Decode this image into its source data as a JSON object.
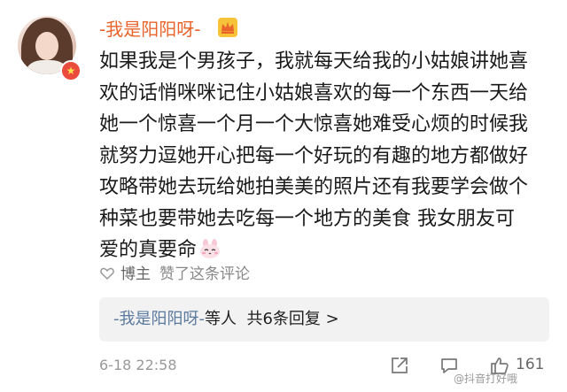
{
  "comment": {
    "username": "-我是阳阳呀-",
    "avatar_badge_icon": "star-badge-icon",
    "crown_icon": "crown-icon",
    "lines": [
      "如果我是个男孩子，我就每天给我的小姑娘讲她喜",
      "欢的话悄咪咪记住小姑娘喜欢的每一个东西一天给",
      "她一个惊喜一个月一个大惊喜她难受心烦的时候我",
      "就努力逗她开心把每一个好玩的有趣的地方都做好",
      "攻略带她去玩给她拍美美的照片还有我要学会做个",
      "种菜也要带她去吃每一个地方的美食 我女朋友可",
      "爱的真要命"
    ],
    "emoji_icon": "bunny-emoji-icon",
    "liked_by_owner": {
      "icon": "heart-outline-icon",
      "owner_label": "博主",
      "text": "赞了这条评论"
    },
    "replies": {
      "name": "-我是阳阳呀-",
      "suffix": "等人",
      "count_text": "共6条回复",
      "chevron": ">"
    },
    "timestamp": "6-18 22:58",
    "actions": {
      "share_icon": "share-icon",
      "comment_icon": "comment-icon",
      "like_icon": "thumbs-up-icon",
      "like_count": "161"
    },
    "watermark": "@抖音打好哦"
  },
  "colors": {
    "username": "#e8642b",
    "reply_name": "#5b7a9e",
    "reply_bg": "#f2f2f2",
    "meta": "#999999"
  }
}
